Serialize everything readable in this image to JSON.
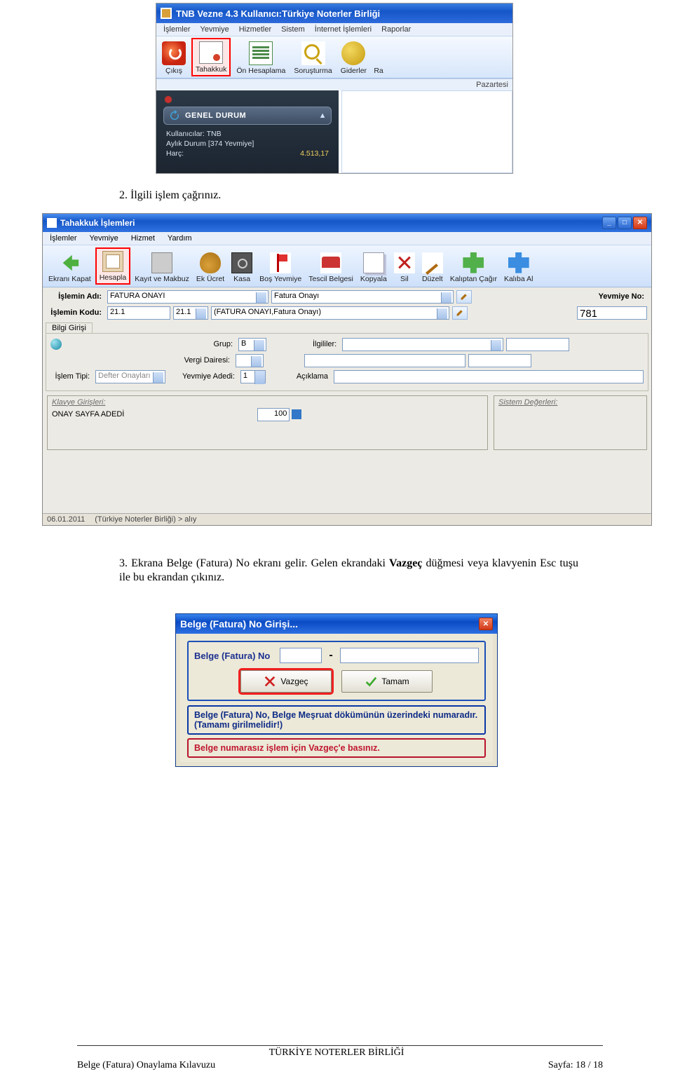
{
  "ss1": {
    "title": "TNB Vezne 4.3  Kullanıcı:Türkiye Noterler Birliği",
    "menu": [
      "İşlemler",
      "Yevmiye",
      "Hizmetler",
      "Sistem",
      "İnternet İşlemleri",
      "Raporlar"
    ],
    "toolbar": [
      {
        "label": "Çıkış",
        "icon": "exit-icon"
      },
      {
        "label": "Tahakkuk",
        "icon": "doc-icon"
      },
      {
        "label": "Ön Hesaplama",
        "icon": "form-icon"
      },
      {
        "label": "Soruşturma",
        "icon": "search-icon"
      },
      {
        "label": "Giderler",
        "icon": "coins-icon"
      },
      {
        "label": "Ra",
        "icon": "blank-icon"
      }
    ],
    "status_day": "Pazartesi",
    "panel": {
      "header": "GENEL DURUM",
      "line1": "Kullanıcılar: TNB",
      "line2": "Aylık Durum [374 Yevmiye]",
      "harc_label": "Harç:",
      "harc_val": "4.513,17"
    }
  },
  "instr2": {
    "num": "2.",
    "text": "İlgili işlem çağrınız."
  },
  "ss2": {
    "title": "Tahakkuk İşlemleri",
    "menu": [
      "İşlemler",
      "Yevmiye",
      "Hizmet",
      "Yardım"
    ],
    "toolbar": [
      "Ekranı Kapat",
      "Hesapla",
      "Kayıt ve Makbuz",
      "Ek Ücret",
      "Kasa",
      "Boş Yevmiye",
      "Tescil Belgesi",
      "Kopyala",
      "Sil",
      "Düzelt",
      "Kalıptan Çağır",
      "Kalıba Al"
    ],
    "fields": {
      "islem_adi_lbl": "İşlemin Adı:",
      "islem_adi_val": "FATURA ONAYI",
      "islem_adi_desc": "Fatura Onayı",
      "islem_kodu_lbl": "İşlemin Kodu:",
      "islem_kodu_val": "21.1",
      "islem_kodu_combo": "21.1",
      "islem_kodu_desc": "(FATURA ONAYI,Fatura Onayı)",
      "yevmiye_no_lbl": "Yevmiye No:",
      "yevmiye_no_val": "781"
    },
    "tab": "Bilgi Girişi",
    "bg": {
      "grup_lbl": "Grup:",
      "grup_val": "B",
      "ilgililer_lbl": "İlgililer:",
      "vergi_lbl": "Vergi Dairesi:",
      "islem_tipi_lbl": "İşlem Tipi:",
      "islem_tipi_val": "Defter Onayları",
      "yevmiye_adedi_lbl": "Yevmiye Adedi:",
      "yevmiye_adedi_val": "1",
      "aciklama_lbl": "Açıklama"
    },
    "panel_kl": {
      "header": "Klavye Girişleri:",
      "row_lbl": "ONAY SAYFA ADEDİ",
      "row_val": "100"
    },
    "panel_sys": {
      "header": "Sistem Değerleri:"
    },
    "status": {
      "date": "06.01.2011",
      "path": "(Türkiye Noterler Birliği) > alıy"
    }
  },
  "instr3": {
    "num": "3.",
    "text_a": "Ekrana Belge (Fatura) No ekranı gelir. Gelen ekrandaki ",
    "bold": "Vazgeç",
    "text_b": " düğmesi veya klavyenin Esc tuşu ile bu ekrandan çıkınız."
  },
  "ss3": {
    "title": "Belge (Fatura) No Girişi...",
    "label": "Belge (Fatura) No",
    "dash": "-",
    "btn_cancel": "Vazgeç",
    "btn_ok": "Tamam",
    "warn": "Belge (Fatura) No, Belge Meşruat dökümünün üzerindeki numaradır. (Tamamı girilmelidir!)",
    "err": "Belge numarasız işlem için Vazgeç'e basınız."
  },
  "footer": {
    "center": "TÜRKİYE NOTERLER BİRLİĞİ",
    "left": "Belge (Fatura) Onaylama Kılavuzu",
    "right": "Sayfa: 18 / 18"
  }
}
